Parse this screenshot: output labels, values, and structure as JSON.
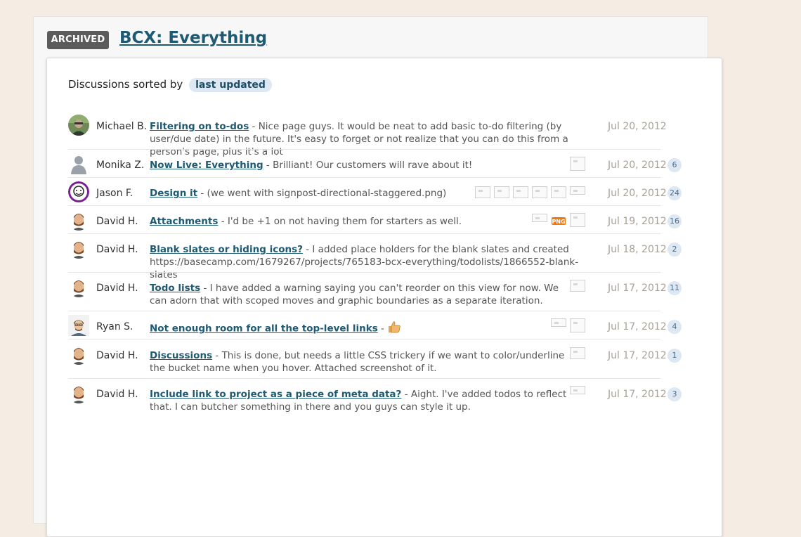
{
  "header": {
    "badge": "ARCHIVED",
    "title": "BCX: Everything"
  },
  "sort": {
    "label": "Discussions sorted by",
    "value": "last updated"
  },
  "discussions": [
    {
      "author": "Michael B.",
      "subject": "Filtering on to-dos",
      "excerpt": " - Nice page guys. It would be neat to add basic to-do filtering (by user/due date) in the future. It's easy to forget or not realize that you can do this from a person's page, plus it's a lot",
      "date": "Jul 20, 2012",
      "count": ""
    },
    {
      "author": "Monika Z.",
      "subject": "Now Live: Everything",
      "excerpt": " - Brilliant! Our customers will rave about it!",
      "date": "Jul 20, 2012",
      "count": "6"
    },
    {
      "author": "Jason F.",
      "subject": "Design it",
      "excerpt": " - (we went with signpost-directional-staggered.png)",
      "date": "Jul 20, 2012",
      "count": "24"
    },
    {
      "author": "David H.",
      "subject": "Attachments",
      "excerpt": " - I'd be +1 on not having them for starters as well.",
      "date": "Jul 19, 2012",
      "count": "16",
      "png_label": "PNG"
    },
    {
      "author": "David H.",
      "subject": "Blank slates or hiding icons?",
      "excerpt": " - I added place holders for the blank slates and created https://basecamp.com/1679267/projects/765183-bcx-everything/todolists/1866552-blank-slates",
      "date": "Jul 18, 2012",
      "count": "2"
    },
    {
      "author": "David H.",
      "subject": "Todo lists",
      "excerpt": " - I have added a warning saying you can't reorder on this view for now. We can adorn that with scoped moves and graphic boundaries as a separate iteration.",
      "date": "Jul 17, 2012",
      "count": "11"
    },
    {
      "author": "Ryan S.",
      "subject": "Not enough room for all the top-level links",
      "excerpt": " - ",
      "date": "Jul 17, 2012",
      "count": "4"
    },
    {
      "author": "David H.",
      "subject": "Discussions",
      "excerpt": " - This is done, but needs a little CSS trickery if we want to color/underline the bucket name when you hover. Attached screenshot of it.",
      "date": "Jul 17, 2012",
      "count": "1"
    },
    {
      "author": "David H.",
      "subject": "Include link to project as a piece of meta data?",
      "excerpt": " - Aight. I've added todos to reflect that. I can butcher something in there and you guys can style it up.",
      "date": "Jul 17, 2012",
      "count": "3"
    }
  ]
}
